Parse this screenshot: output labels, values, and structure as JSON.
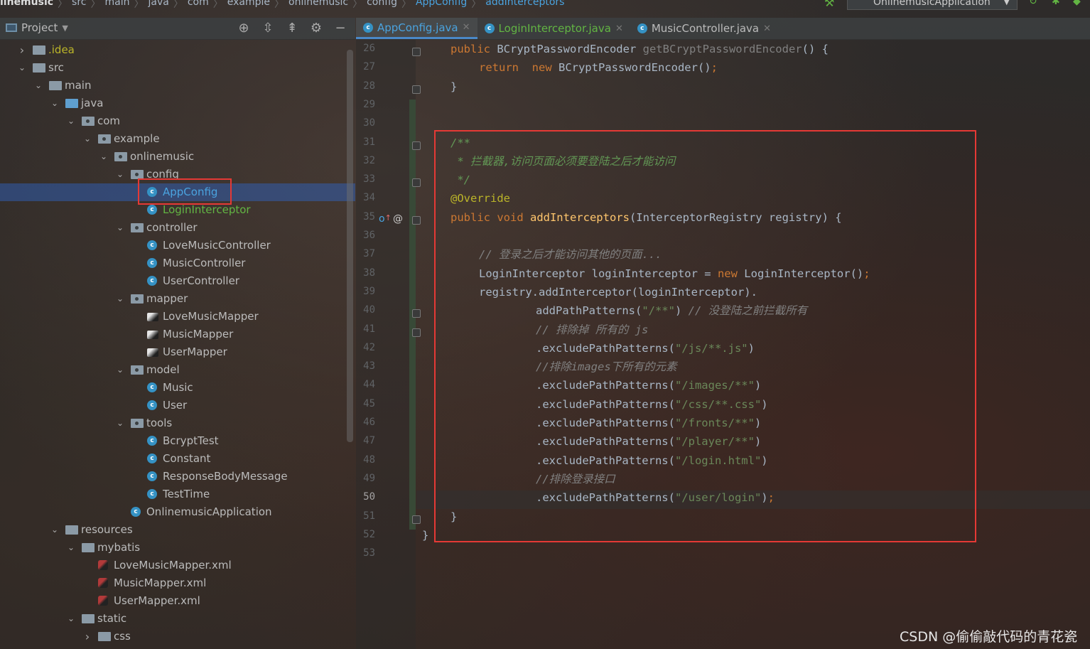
{
  "breadcrumb": [
    "linemusic",
    "src",
    "main",
    "java",
    "com",
    "example",
    "onlinemusic",
    "config",
    "AppConfig",
    "addInterceptors"
  ],
  "run_config": "OnlinemusicApplication",
  "project_panel": {
    "title": "Project"
  },
  "tabs": [
    {
      "label": "AppConfig.java",
      "state": "active"
    },
    {
      "label": "LoginInterceptor.java",
      "state": "modified"
    },
    {
      "label": "MusicController.java",
      "state": "normal"
    }
  ],
  "tree": [
    {
      "label": ".idea",
      "depth": 0,
      "kind": "folder",
      "expanded": false,
      "color": "#bbb529"
    },
    {
      "label": "src",
      "depth": 0,
      "kind": "folder",
      "expanded": true
    },
    {
      "label": "main",
      "depth": 1,
      "kind": "folder",
      "expanded": true
    },
    {
      "label": "java",
      "depth": 2,
      "kind": "folder-blue",
      "expanded": true
    },
    {
      "label": "com",
      "depth": 3,
      "kind": "package",
      "expanded": true
    },
    {
      "label": "example",
      "depth": 4,
      "kind": "package",
      "expanded": true
    },
    {
      "label": "onlinemusic",
      "depth": 5,
      "kind": "package",
      "expanded": true
    },
    {
      "label": "config",
      "depth": 6,
      "kind": "package",
      "expanded": true
    },
    {
      "label": "AppConfig",
      "depth": 7,
      "kind": "class",
      "selected": true,
      "color": "#4aa3df"
    },
    {
      "label": "LoginInterceptor",
      "depth": 7,
      "kind": "class",
      "color": "#62b543"
    },
    {
      "label": "controller",
      "depth": 6,
      "kind": "package",
      "expanded": true
    },
    {
      "label": "LoveMusicController",
      "depth": 7,
      "kind": "class"
    },
    {
      "label": "MusicController",
      "depth": 7,
      "kind": "class"
    },
    {
      "label": "UserController",
      "depth": 7,
      "kind": "class"
    },
    {
      "label": "mapper",
      "depth": 6,
      "kind": "package",
      "expanded": true
    },
    {
      "label": "LoveMusicMapper",
      "depth": 7,
      "kind": "mapper"
    },
    {
      "label": "MusicMapper",
      "depth": 7,
      "kind": "mapper"
    },
    {
      "label": "UserMapper",
      "depth": 7,
      "kind": "mapper"
    },
    {
      "label": "model",
      "depth": 6,
      "kind": "package",
      "expanded": true
    },
    {
      "label": "Music",
      "depth": 7,
      "kind": "class"
    },
    {
      "label": "User",
      "depth": 7,
      "kind": "class"
    },
    {
      "label": "tools",
      "depth": 6,
      "kind": "package",
      "expanded": true
    },
    {
      "label": "BcryptTest",
      "depth": 7,
      "kind": "class-run"
    },
    {
      "label": "Constant",
      "depth": 7,
      "kind": "class"
    },
    {
      "label": "ResponseBodyMessage",
      "depth": 7,
      "kind": "class"
    },
    {
      "label": "TestTime",
      "depth": 7,
      "kind": "class-run"
    },
    {
      "label": "OnlinemusicApplication",
      "depth": 6,
      "kind": "class-run"
    },
    {
      "label": "resources",
      "depth": 2,
      "kind": "folder-res",
      "expanded": true
    },
    {
      "label": "mybatis",
      "depth": 3,
      "kind": "folder",
      "expanded": true
    },
    {
      "label": "LoveMusicMapper.xml",
      "depth": 4,
      "kind": "xml"
    },
    {
      "label": "MusicMapper.xml",
      "depth": 4,
      "kind": "xml"
    },
    {
      "label": "UserMapper.xml",
      "depth": 4,
      "kind": "xml"
    },
    {
      "label": "static",
      "depth": 3,
      "kind": "folder",
      "expanded": true
    },
    {
      "label": "css",
      "depth": 4,
      "kind": "folder",
      "expanded": false
    }
  ],
  "editor": {
    "current_line": 50,
    "lines": [
      {
        "n": "26",
        "indent": 1,
        "t": [
          [
            "kw",
            "public "
          ],
          [
            "",
            "BCryptPasswordEncoder "
          ],
          [
            "gr",
            "getBCryptPasswordEncoder"
          ],
          [
            "",
            "() {"
          ]
        ]
      },
      {
        "n": "27",
        "indent": 2,
        "t": [
          [
            "kw",
            "return  new "
          ],
          [
            "",
            "BCryptPasswordEncoder()"
          ],
          [
            "kw",
            ";"
          ]
        ]
      },
      {
        "n": "28",
        "indent": 1,
        "t": [
          [
            "",
            "}"
          ]
        ]
      },
      {
        "n": "29",
        "indent": 0,
        "t": []
      },
      {
        "n": "30",
        "indent": 0,
        "t": []
      },
      {
        "n": "31",
        "indent": 1,
        "t": [
          [
            "cm",
            "/**"
          ]
        ]
      },
      {
        "n": "32",
        "indent": 1,
        "t": [
          [
            "cm",
            " * 拦截器,访问页面必须要登陆之后才能访问"
          ]
        ]
      },
      {
        "n": "33",
        "indent": 1,
        "t": [
          [
            "cm",
            " */"
          ]
        ]
      },
      {
        "n": "34",
        "indent": 1,
        "t": [
          [
            "an",
            "@Override"
          ]
        ]
      },
      {
        "n": "35",
        "indent": 1,
        "t": [
          [
            "kw",
            "public void "
          ],
          [
            "fn",
            "addInterceptors"
          ],
          [
            "",
            "(InterceptorRegistry registry) {"
          ]
        ]
      },
      {
        "n": "36",
        "indent": 0,
        "t": []
      },
      {
        "n": "37",
        "indent": 2,
        "t": [
          [
            "lc",
            "// 登录之后才能访问其他的页面..."
          ]
        ]
      },
      {
        "n": "38",
        "indent": 2,
        "t": [
          [
            "",
            "LoginInterceptor loginInterceptor = "
          ],
          [
            "kw",
            "new "
          ],
          [
            "",
            "LoginInterceptor()"
          ],
          [
            "kw",
            ";"
          ]
        ]
      },
      {
        "n": "39",
        "indent": 2,
        "t": [
          [
            "",
            "registry.addInterceptor(loginInterceptor)."
          ]
        ]
      },
      {
        "n": "40",
        "indent": 4,
        "t": [
          [
            "",
            "addPathPatterns("
          ],
          [
            "st",
            "\"/**\""
          ],
          [
            "",
            ") "
          ],
          [
            "lc",
            "// 没登陆之前拦截所有"
          ]
        ]
      },
      {
        "n": "41",
        "indent": 4,
        "t": [
          [
            "lc",
            "// 排除掉 所有的 js"
          ]
        ]
      },
      {
        "n": "42",
        "indent": 4,
        "t": [
          [
            "",
            ".excludePathPatterns("
          ],
          [
            "st",
            "\"/js/**.js\""
          ],
          [
            "",
            ")"
          ]
        ]
      },
      {
        "n": "43",
        "indent": 4,
        "t": [
          [
            "lc",
            "//排除images下所有的元素"
          ]
        ]
      },
      {
        "n": "44",
        "indent": 4,
        "t": [
          [
            "",
            ".excludePathPatterns("
          ],
          [
            "st",
            "\"/images/**\""
          ],
          [
            "",
            ")"
          ]
        ]
      },
      {
        "n": "45",
        "indent": 4,
        "t": [
          [
            "",
            ".excludePathPatterns("
          ],
          [
            "st",
            "\"/css/**.css\""
          ],
          [
            "",
            ")"
          ]
        ]
      },
      {
        "n": "46",
        "indent": 4,
        "t": [
          [
            "",
            ".excludePathPatterns("
          ],
          [
            "st",
            "\"/fronts/**\""
          ],
          [
            "",
            ")"
          ]
        ]
      },
      {
        "n": "47",
        "indent": 4,
        "t": [
          [
            "",
            ".excludePathPatterns("
          ],
          [
            "st",
            "\"/player/**\""
          ],
          [
            "",
            ")"
          ]
        ]
      },
      {
        "n": "48",
        "indent": 4,
        "t": [
          [
            "",
            ".excludePathPatterns("
          ],
          [
            "st",
            "\"/login.html\""
          ],
          [
            "",
            ")"
          ]
        ]
      },
      {
        "n": "49",
        "indent": 4,
        "t": [
          [
            "lc",
            "//排除登录接口"
          ]
        ]
      },
      {
        "n": "50",
        "indent": 4,
        "t": [
          [
            "",
            ".excludePathPatterns("
          ],
          [
            "st",
            "\"/user/login\""
          ],
          [
            "",
            ")"
          ],
          [
            "kw",
            ";"
          ]
        ]
      },
      {
        "n": "51",
        "indent": 1,
        "t": [
          [
            "",
            "}"
          ]
        ]
      },
      {
        "n": "52",
        "indent": 0,
        "t": [
          [
            "",
            "}"
          ]
        ]
      },
      {
        "n": "53",
        "indent": 0,
        "t": []
      }
    ]
  },
  "watermark": "CSDN @偷偷敲代码的青花瓷",
  "colors": {
    "highlight_box": "#e53935",
    "accent": "#4a88c7"
  }
}
